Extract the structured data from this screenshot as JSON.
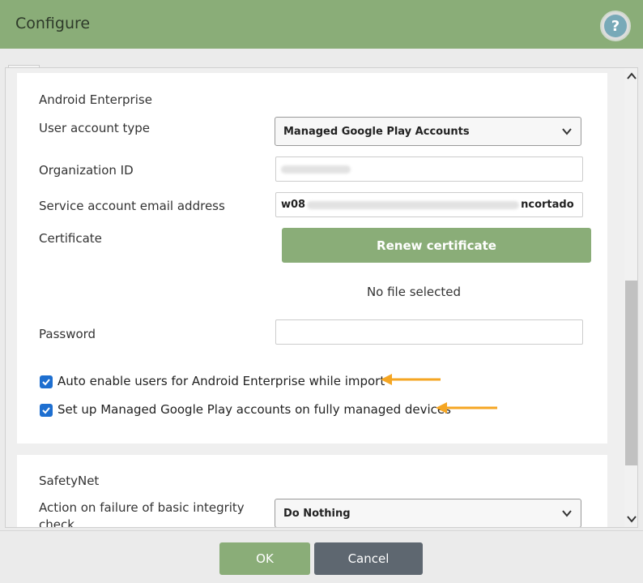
{
  "dialog": {
    "title": "Configure",
    "help_label": "?"
  },
  "android_enterprise": {
    "section_title": "Android Enterprise",
    "user_account_type_label": "User account type",
    "user_account_type_value": "Managed Google Play Accounts",
    "organization_id_label": "Organization ID",
    "service_account_label": "Service account email address",
    "service_account_prefix": "w08",
    "service_account_suffix": "ncortado",
    "certificate_label": "Certificate",
    "renew_button": "Renew certificate",
    "no_file": "No file selected",
    "password_label": "Password",
    "checkbox_auto_enable": "Auto enable users for Android Enterprise while import",
    "checkbox_managed_play": "Set up Managed Google Play accounts on fully managed devices",
    "checkbox_auto_enable_checked": true,
    "checkbox_managed_play_checked": true
  },
  "safetynet": {
    "section_title": "SafetyNet",
    "action_label_line1": "Action on failure of basic integrity",
    "action_label_line2": "check",
    "action_value": "Do Nothing"
  },
  "footer": {
    "ok_label": "OK",
    "cancel_label": "Cancel"
  },
  "colors": {
    "header": "#8aad78",
    "accent_green": "#8aad78",
    "cancel": "#5e6770",
    "checkbox": "#1e6fd0",
    "arrow": "#f5a623"
  }
}
